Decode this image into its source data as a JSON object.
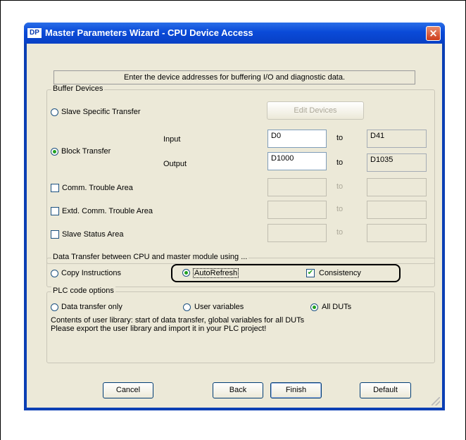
{
  "window": {
    "title": "Master Parameters Wizard - CPU Device Access",
    "icon_label": "DP",
    "close": "×"
  },
  "info_text": "Enter the device addresses for buffering I/O and diagnostic data.",
  "buffer": {
    "legend": "Buffer Devices",
    "slave_specific": "Slave Specific Transfer",
    "edit_devices": "Edit Devices",
    "block_transfer": "Block Transfer",
    "input_label": "Input",
    "output_label": "Output",
    "to": "to",
    "input_start": "D0",
    "input_end": "D41",
    "output_start": "D1000",
    "output_end": "D1035",
    "comm_trouble": "Comm. Trouble Area",
    "extd_comm_trouble": "Extd. Comm. Trouble Area",
    "slave_status": "Slave Status Area"
  },
  "transfer": {
    "legend": "Data Transfer between CPU and master module using ...",
    "copy_instructions": "Copy Instructions",
    "autorefresh": "AutoRefresh",
    "consistency": "Consistency"
  },
  "plc": {
    "legend": "PLC code options",
    "data_transfer_only": "Data transfer only",
    "user_variables": "User variables",
    "all_duts": "All DUTs",
    "desc1": "Contents of user library: start of data transfer, global variables for all DUTs",
    "desc2": "Please export the user library and import it in your PLC project!"
  },
  "buttons": {
    "cancel": "Cancel",
    "back": "Back",
    "finish": "Finish",
    "default": "Default"
  }
}
